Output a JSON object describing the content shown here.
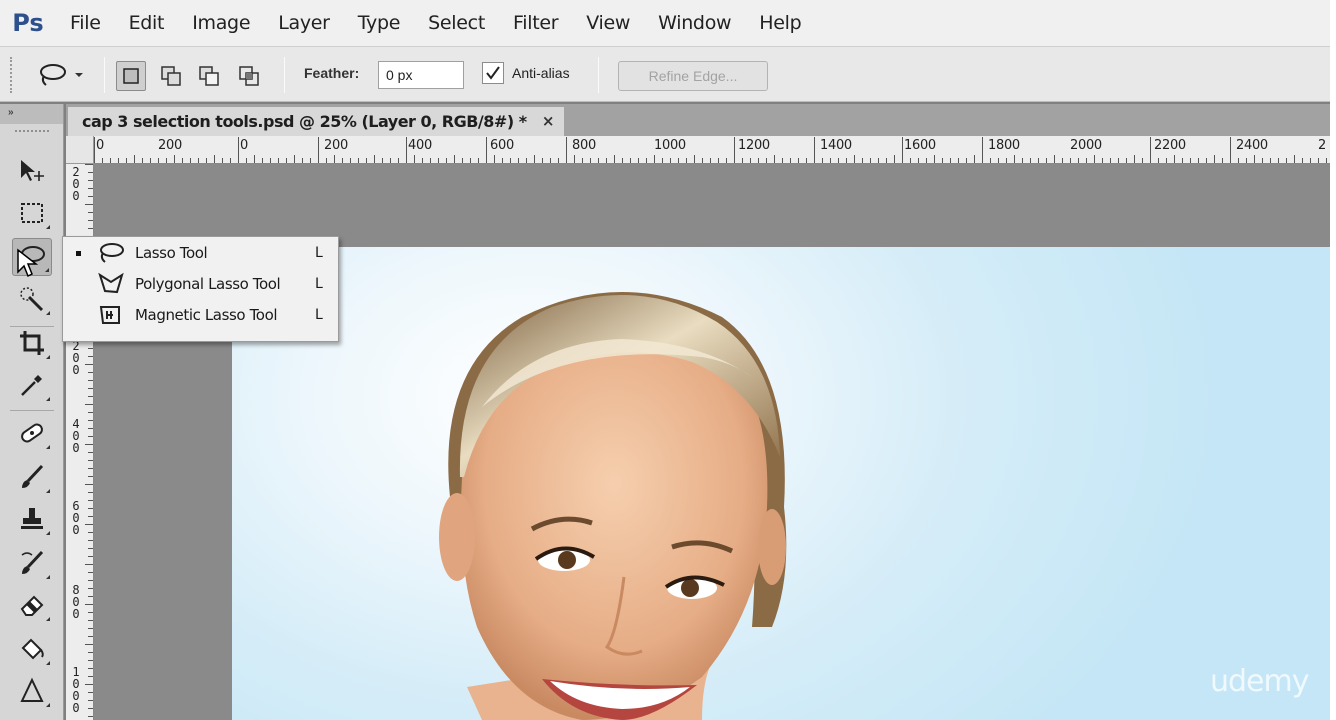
{
  "app": {
    "logo": "Ps"
  },
  "menu": [
    "File",
    "Edit",
    "Image",
    "Layer",
    "Type",
    "Select",
    "Filter",
    "View",
    "Window",
    "Help"
  ],
  "options": {
    "tool_icon": "lasso-icon",
    "selection_modes": [
      "new-selection",
      "add-to-selection",
      "subtract-from-selection",
      "intersect-selection"
    ],
    "feather_label": "Feather:",
    "feather_value": "0 px",
    "antialias_label": "Anti-alias",
    "antialias_checked": true,
    "refine_edge_label": "Refine Edge..."
  },
  "toolbar": {
    "collapse_label": "»",
    "tools": [
      "move-icon",
      "rectangular-marquee-icon",
      "lasso-icon",
      "quick-selection-icon",
      "crop-icon",
      "eyedropper-icon",
      "spot-healing-icon",
      "brush-icon",
      "clone-stamp-icon",
      "history-brush-icon",
      "eraser-icon",
      "paint-bucket-icon",
      "sharpen-icon"
    ]
  },
  "document": {
    "tab_title": "cap 3 selection tools.psd @ 25% (Layer 0, RGB/8#) *",
    "close_label": "×",
    "hruler_labels": [
      "0",
      "200",
      "0",
      "200",
      "400",
      "600",
      "800",
      "1000",
      "1200",
      "1400",
      "1600",
      "1800",
      "2000",
      "2200",
      "2400",
      "2"
    ],
    "vruler_labels": [
      "200",
      "",
      "200",
      "400",
      "600",
      "800",
      "1000"
    ]
  },
  "flyout": {
    "items": [
      {
        "label": "Lasso Tool",
        "shortcut": "L",
        "icon": "lasso-icon",
        "selected": true
      },
      {
        "label": "Polygonal Lasso Tool",
        "shortcut": "L",
        "icon": "polygonal-lasso-icon",
        "selected": false
      },
      {
        "label": "Magnetic Lasso Tool",
        "shortcut": "L",
        "icon": "magnetic-lasso-icon",
        "selected": false
      }
    ]
  },
  "watermark": "udemy",
  "colors": {
    "menubar_bg": "#f0f0f0",
    "canvas_bg": "#8a8a8a",
    "logo": "#2d4f8c",
    "photo_bg": "#c4e6f6"
  }
}
